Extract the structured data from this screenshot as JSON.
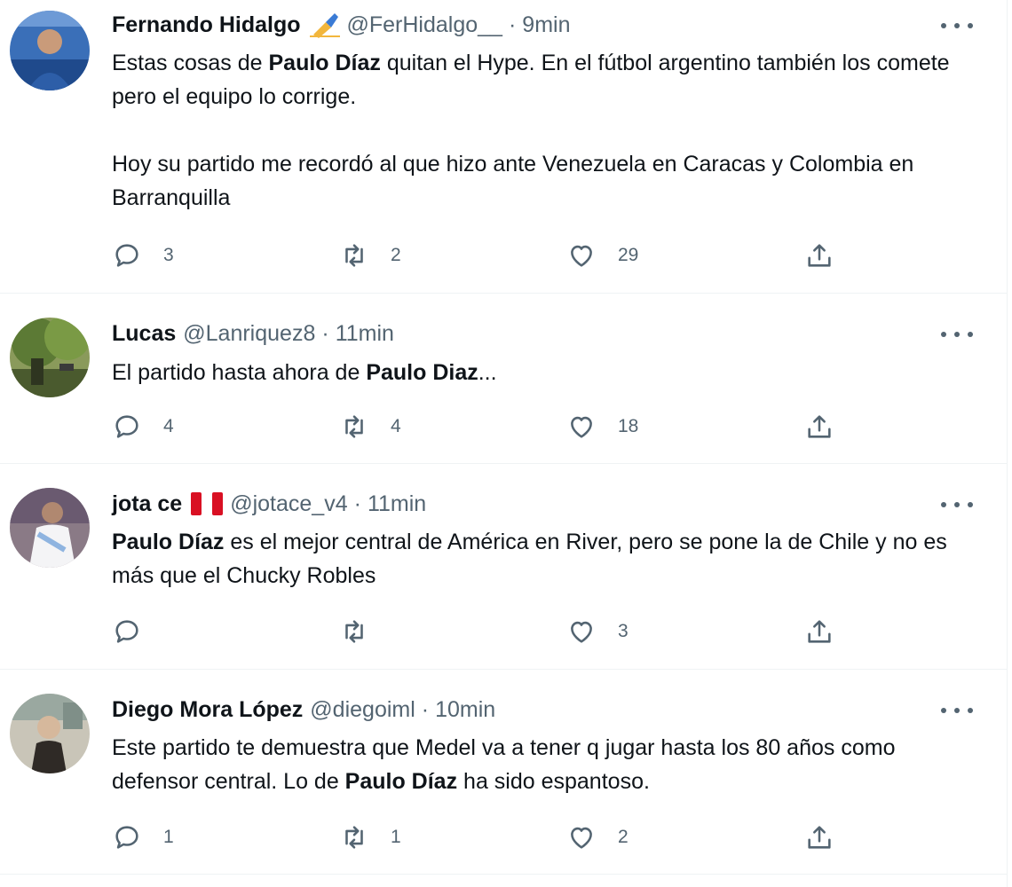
{
  "icons": {
    "more": "more-horizontal-icon",
    "reply": "reply-icon",
    "retweet": "retweet-icon",
    "like": "heart-icon",
    "share": "share-icon"
  },
  "colors": {
    "text_primary": "#0f1419",
    "text_secondary": "#536471",
    "divider": "#eff3f4"
  },
  "tweets": [
    {
      "name": "Fernando Hidalgo",
      "emoji": "✍",
      "handle": "@FerHidalgo__",
      "separator": "·",
      "time": "9min",
      "text_parts": [
        "Estas cosas de ",
        "Paulo Díaz",
        " quitan el Hype. En el fútbol argentino también los comete pero el equipo lo corrige.",
        "Hoy su partido me recordó al que hizo ante Venezuela en Caracas y Colombia en Barranquilla"
      ],
      "replies": "3",
      "retweets": "2",
      "likes": "29"
    },
    {
      "name": "Lucas",
      "handle": "@Lanriquez8",
      "separator": "·",
      "time": "11min",
      "text_parts": [
        "El partido hasta ahora de ",
        "Paulo Diaz",
        "..."
      ],
      "replies": "4",
      "retweets": "4",
      "likes": "18"
    },
    {
      "name": "jota ce",
      "emoji": "🇵🇪",
      "handle": "@jotace_v4",
      "separator": "·",
      "time": "11min",
      "text_parts": [
        "Paulo Díaz",
        " es el mejor central de América en River, pero se pone la de Chile y no es más que el Chucky Robles"
      ],
      "replies": "",
      "retweets": "",
      "likes": "3"
    },
    {
      "name": "Diego Mora López",
      "handle": "@diegoiml",
      "separator": "·",
      "time": "10min",
      "text_parts": [
        "Este partido te demuestra que Medel va a tener q jugar hasta los 80 años como defensor central. Lo de ",
        "Paulo Díaz",
        " ha sido espantoso."
      ],
      "replies": "1",
      "retweets": "1",
      "likes": "2"
    }
  ]
}
